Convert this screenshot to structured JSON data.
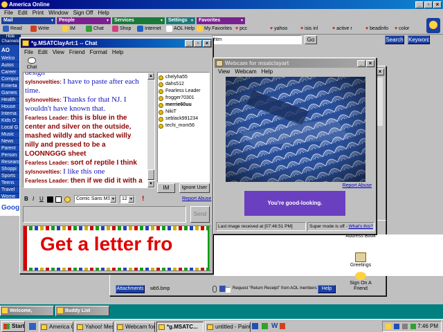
{
  "aol": {
    "title": "America  Online",
    "menu": [
      "File",
      "Edit",
      "Print",
      "Window",
      "Sign Off",
      "Help"
    ],
    "toolbar_groups": [
      {
        "label": "Mail",
        "color": "#1a3fa0"
      },
      {
        "label": "People",
        "color": "#7a2090"
      },
      {
        "label": "Services",
        "color": "#1a7a3a"
      },
      {
        "label": "Settings",
        "color": "#1a7a7a"
      },
      {
        "label": "Favorites",
        "color": "#7a2090"
      }
    ],
    "toolbar_buttons": [
      "Read",
      "Write",
      "IM",
      "Chat",
      "Shop",
      "Internet",
      "AOL Help",
      "My Favorites"
    ],
    "favorites": [
      "pcc",
      "yahoo",
      "isis inl",
      "active r",
      "beadinfo",
      "color"
    ],
    "url_fragment": "htm",
    "go_label": "Go",
    "search_label": "Search",
    "keyword_label": "Keyword",
    "sidebar_title": "AO",
    "channels_label": "Channels",
    "sidebar": [
      "Welco",
      "Autos",
      "Career",
      "Comput",
      "Enterta",
      "Games",
      "Health",
      "House",
      "Interna",
      "Kids O",
      "Local G",
      "Music",
      "News",
      "Parent",
      "Person",
      "Researc",
      "Shoppi",
      "Sports",
      "Teens",
      "Travel",
      "Wome"
    ]
  },
  "chat": {
    "title": "*g.MSATClayArt:1 -- Chat",
    "menu": [
      "File",
      "Edit",
      "View",
      "Friend",
      "Format",
      "Help"
    ],
    "chat_icon_label": "Chat",
    "messages": [
      {
        "sn": "",
        "text": "design",
        "style": "nv"
      },
      {
        "sn": "sylsnovelties:",
        "text": "I have to paste after each time.",
        "style": "nv"
      },
      {
        "sn": "sylsnovelties:",
        "text": "Thanks for that NJ. I wouldn't have known that.",
        "style": "nv"
      },
      {
        "sn": "Fearless Leader:",
        "text": "this is blue in the center and silver on the outside, mashed wildly and stacked willy nilly and pressed to be a LOONNGGG sheet",
        "style": "fl"
      },
      {
        "sn": "Fearless Leader:",
        "text": "sort of reptile I think",
        "style": "fl"
      },
      {
        "sn": "sylsnovelties:",
        "text": "I like this one",
        "style": "nv"
      },
      {
        "sn": "Fearless Leader:",
        "text": "then if we did it with a",
        "style": "fl"
      }
    ],
    "buddies": [
      "chelyha55",
      "dahs512",
      "Fearless Leader",
      "frogger70301",
      "merrie60uu",
      "NikiT",
      "seblack991234",
      "techi_mom56"
    ],
    "im_label": "IM",
    "ignore_label": "Ignore User",
    "font_name": "Comic Sans MS",
    "font_size": "12",
    "report_abuse": "Report Abuse",
    "send_label": "Send",
    "banner_text": "Get a letter fro"
  },
  "webcam": {
    "title": "Webcam for msatclayart",
    "menu": [
      "View",
      "Webcam",
      "Help"
    ],
    "report_abuse": "Report Abuse",
    "ad_text": "You're good-looking.",
    "last_image": "Last image received at [07:46:51 PM]",
    "super_mode": "Super mode is off -",
    "whats_this": "What's this?"
  },
  "mail": {
    "attachments_label": "Attachments",
    "filename": "wb5.bmp",
    "receipt_label": "Request \"Return Receipt\" from AOL members",
    "help_label": "Help",
    "side_buttons": [
      "Address Book",
      "Greetings",
      "Sign On A Friend"
    ]
  },
  "minimized": [
    {
      "label": "Welcome, "
    },
    {
      "label": "Buddy List"
    }
  ],
  "taskbar": {
    "start_label": "Start",
    "items": [
      "America Onli...",
      "Yahoo! Mess...",
      "Webcam for ...",
      "*g.MSATC...",
      "untitled - Paint"
    ],
    "active_index": 3,
    "clock": "7:46 PM"
  }
}
